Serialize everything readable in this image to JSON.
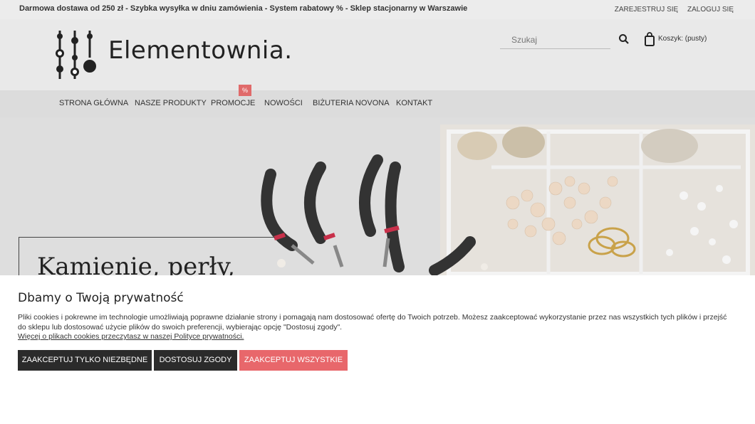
{
  "topbar": {
    "promo_text": "Darmowa dostawa od 250 zł - Szybka wysyłka w dniu zamówienia - System rabatowy % - Sklep stacjonarny w Warszawie",
    "register_label": "ZAREJESTRUJ SIĘ",
    "login_label": "ZALOGUJ SIĘ"
  },
  "header": {
    "logo_text": "Elementownia.",
    "search": {
      "placeholder": "Szukaj"
    },
    "cart": {
      "label": "Koszyk: (pusty)"
    }
  },
  "nav": {
    "items": [
      {
        "label": "STRONA GŁÓWNA"
      },
      {
        "label": "NASZE PRODUKTY"
      },
      {
        "label": "PROMOCJE"
      },
      {
        "label": "NOWOŚCI"
      },
      {
        "label": "BIŻUTERIA NOVONA"
      },
      {
        "label": "KONTAKT"
      }
    ],
    "promo_badge": "%"
  },
  "hero": {
    "heading": "Kamienie, perły,"
  },
  "cookie": {
    "title": "Dbamy o Twoją prywatność",
    "description": "Pliki cookies i pokrewne im technologie umożliwiają poprawne działanie strony i pomagają nam dostosować ofertę do Twoich potrzeb. Możesz zaakceptować wykorzystanie przez nas wszystkich tych plików i przejść do sklepu lub dostosować użycie plików do swoich preferencji, wybierając opcję \"Dostosuj zgody\".",
    "more_link": "Więcej o plikach cookies przeczytasz w naszej Polityce prywatności.",
    "buttons": {
      "necessary": "ZAAKCEPTUJ TYLKO NIEZBĘDNE",
      "customize": "DOSTOSUJ ZGODY",
      "accept_all": "ZAAKCEPTUJ WSZYSTKIE"
    }
  }
}
